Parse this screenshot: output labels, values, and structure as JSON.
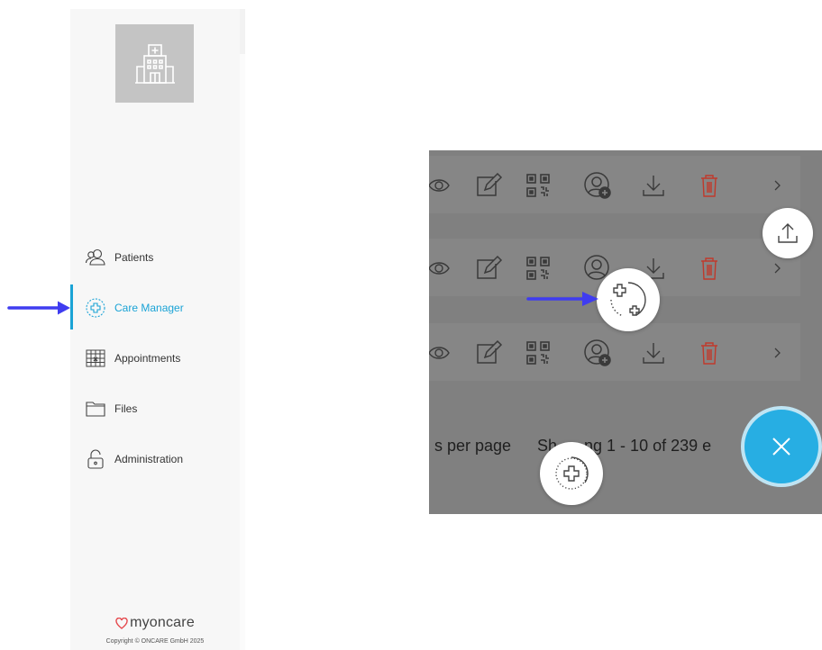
{
  "sidebar": {
    "logo_icon": "hospital-icon",
    "items": [
      {
        "label": "Patients",
        "icon": "patients-icon",
        "active": false
      },
      {
        "label": "Care Manager",
        "icon": "care-manager-icon",
        "active": true
      },
      {
        "label": "Appointments",
        "icon": "calendar-icon",
        "active": false
      },
      {
        "label": "Files",
        "icon": "folder-icon",
        "active": false
      },
      {
        "label": "Administration",
        "icon": "lock-icon",
        "active": false
      }
    ],
    "brand": "myoncare",
    "copyright": "Copyright © ONCARE GmbH 2025"
  },
  "zoom": {
    "pager_left": "s per page",
    "pager_right": "Sh      ng 1 - 10 of 239 e"
  },
  "colors": {
    "accent": "#1aa3d6",
    "arrow": "#3f3cf0",
    "fab": "#27aee3",
    "delete": "#c0392b",
    "brand_heart": "#e5474b"
  }
}
